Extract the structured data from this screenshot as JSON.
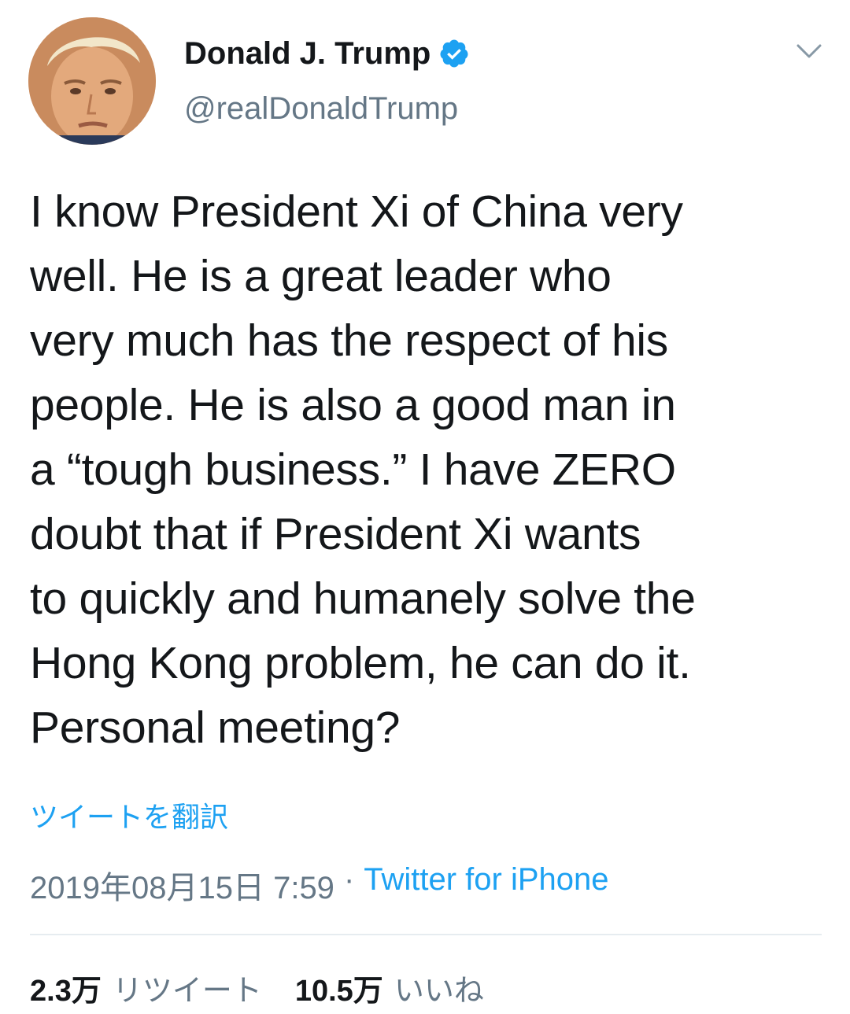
{
  "author": {
    "display_name": "Donald J. Trump",
    "handle": "@realDonaldTrump",
    "verified_icon": "verified-badge-icon",
    "avatar_icon": "avatar-photo"
  },
  "tweet": {
    "text": "I know President Xi of China very\nwell. He is a great leader who\nvery much has the respect of his\npeople. He is also a good man in\na “tough business.” I have ZERO\ndoubt that if President Xi wants\nto quickly and humanely solve the\nHong Kong problem, he can do it.\nPersonal meeting?",
    "translate_label": "ツイートを翻訳",
    "timestamp": "2019年08月15日 7:59",
    "separator": "·",
    "source": "Twitter for iPhone"
  },
  "stats": {
    "retweets_count": "2.3万",
    "retweets_label": "リツイート",
    "likes_count": "10.5万",
    "likes_label": "いいね"
  },
  "colors": {
    "accent": "#1da1f2",
    "text_primary": "#14171a",
    "text_secondary": "#657786",
    "divider": "#e6ecf0"
  }
}
